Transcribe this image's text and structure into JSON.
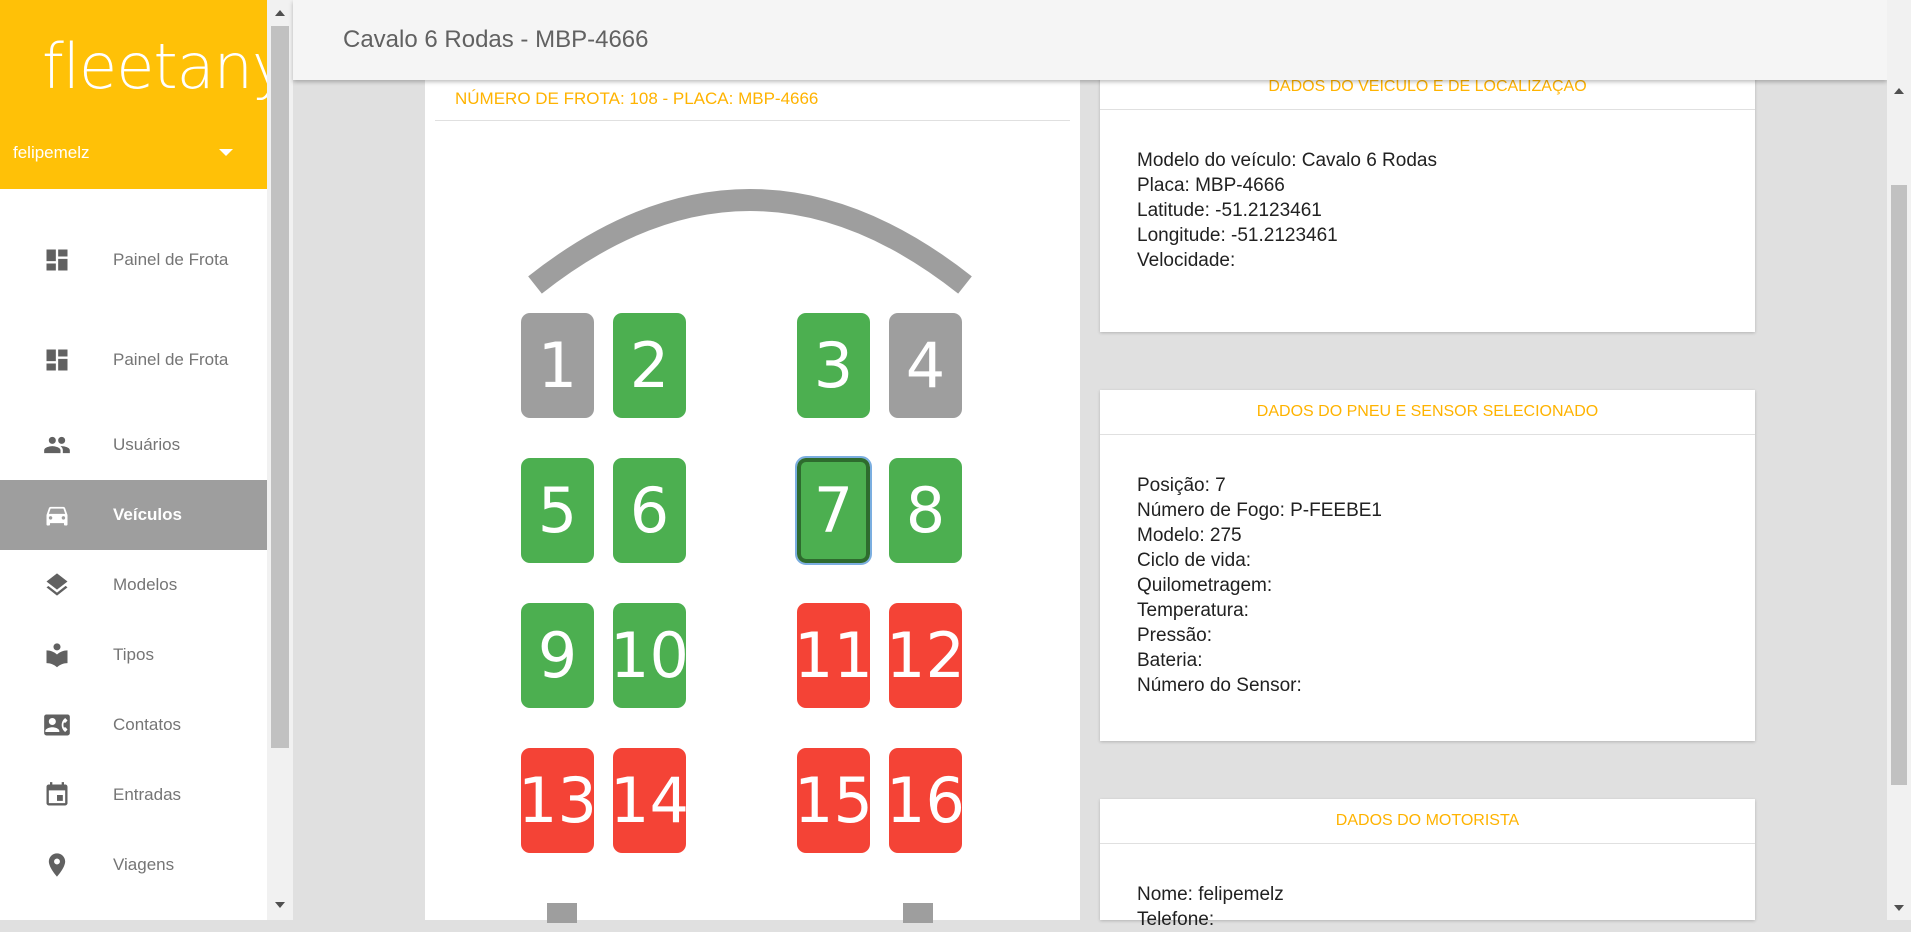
{
  "brand": {
    "logo": "fleetany",
    "user": "felipemelz"
  },
  "nav": [
    {
      "label": "Painel de Frota",
      "icon": "dashboard-icon"
    },
    {
      "label": "Painel de Frota",
      "icon": "dashboard-icon"
    },
    {
      "label": "Usuários",
      "icon": "people-icon"
    },
    {
      "label": "Veículos",
      "icon": "car-icon",
      "active": true
    },
    {
      "label": "Modelos",
      "icon": "layers-icon"
    },
    {
      "label": "Tipos",
      "icon": "book-icon"
    },
    {
      "label": "Contatos",
      "icon": "contact-card-icon"
    },
    {
      "label": "Entradas",
      "icon": "calendar-icon"
    },
    {
      "label": "Viagens",
      "icon": "location-pin-icon"
    }
  ],
  "header": {
    "title": "Cavalo 6 Rodas - MBP-4666"
  },
  "vehicle": {
    "header": "NÚMERO DE FROTA: 108 - PLACA: MBP-4666",
    "tires": [
      {
        "label": "1",
        "status": "gray"
      },
      {
        "label": "2",
        "status": "green"
      },
      {
        "label": "3",
        "status": "green"
      },
      {
        "label": "4",
        "status": "gray"
      },
      {
        "label": "5",
        "status": "green"
      },
      {
        "label": "6",
        "status": "green"
      },
      {
        "label": "7",
        "status": "green",
        "selected": true
      },
      {
        "label": "8",
        "status": "green"
      },
      {
        "label": "9",
        "status": "green"
      },
      {
        "label": "10",
        "status": "green"
      },
      {
        "label": "11",
        "status": "red"
      },
      {
        "label": "12",
        "status": "red"
      },
      {
        "label": "13",
        "status": "red"
      },
      {
        "label": "14",
        "status": "red"
      },
      {
        "label": "15",
        "status": "red"
      },
      {
        "label": "16",
        "status": "red"
      }
    ]
  },
  "vehicle_info": {
    "title": "DADOS DO VEÍCULO E DE LOCALIZAÇÃO",
    "lines": [
      "Modelo do veículo: Cavalo 6 Rodas",
      "Placa: MBP-4666",
      "Latitude: -51.2123461",
      "Longitude: -51.2123461",
      "Velocidade:"
    ]
  },
  "tire_info": {
    "title": "DADOS DO PNEU E SENSOR SELECIONADO",
    "lines": [
      "Posição: 7",
      "Número de Fogo: P-FEEBE1",
      "Modelo: 275",
      "Ciclo de vida:",
      "Quilometragem:",
      "Temperatura:",
      "Pressão:",
      "Bateria:",
      "Número do Sensor:"
    ]
  },
  "driver_info": {
    "title": "DADOS DO MOTORISTA",
    "lines": [
      "Nome: felipemelz",
      "Telefone:"
    ]
  },
  "colors": {
    "brand": "#ffc107",
    "accent_text": "#ffb300",
    "tire_green": "#4caf50",
    "tire_gray": "#9e9e9e",
    "tire_red": "#f44336",
    "nav_active": "#9e9e9e"
  }
}
